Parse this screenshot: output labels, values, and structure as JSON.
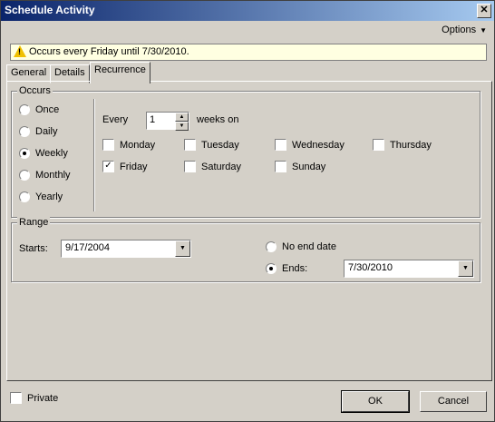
{
  "window": {
    "title": "Schedule Activity",
    "close": "✕"
  },
  "menu": {
    "options_label": "Options"
  },
  "banner": {
    "text": "Occurs every Friday until 7/30/2010."
  },
  "tabs": [
    {
      "label": "General"
    },
    {
      "label": "Details"
    },
    {
      "label": "Recurrence",
      "active": true
    }
  ],
  "occurs": {
    "legend": "Occurs",
    "options": [
      {
        "label": "Once",
        "selected": false
      },
      {
        "label": "Daily",
        "selected": false
      },
      {
        "label": "Weekly",
        "selected": true
      },
      {
        "label": "Monthly",
        "selected": false
      },
      {
        "label": "Yearly",
        "selected": false
      }
    ],
    "every_label": "Every",
    "every_value": "1",
    "weeks_on_label": "weeks on",
    "days": [
      {
        "label": "Monday",
        "checked": false
      },
      {
        "label": "Tuesday",
        "checked": false
      },
      {
        "label": "Wednesday",
        "checked": false
      },
      {
        "label": "Thursday",
        "checked": false
      },
      {
        "label": "Friday",
        "checked": true
      },
      {
        "label": "Saturday",
        "checked": false
      },
      {
        "label": "Sunday",
        "checked": false
      }
    ]
  },
  "range": {
    "legend": "Range",
    "starts_label": "Starts:",
    "starts_value": "9/17/2004",
    "no_end_label": "No end date",
    "ends_label": "Ends:",
    "ends_value": "7/30/2010"
  },
  "footer": {
    "private_label": "Private",
    "ok_label": "OK",
    "cancel_label": "Cancel"
  }
}
